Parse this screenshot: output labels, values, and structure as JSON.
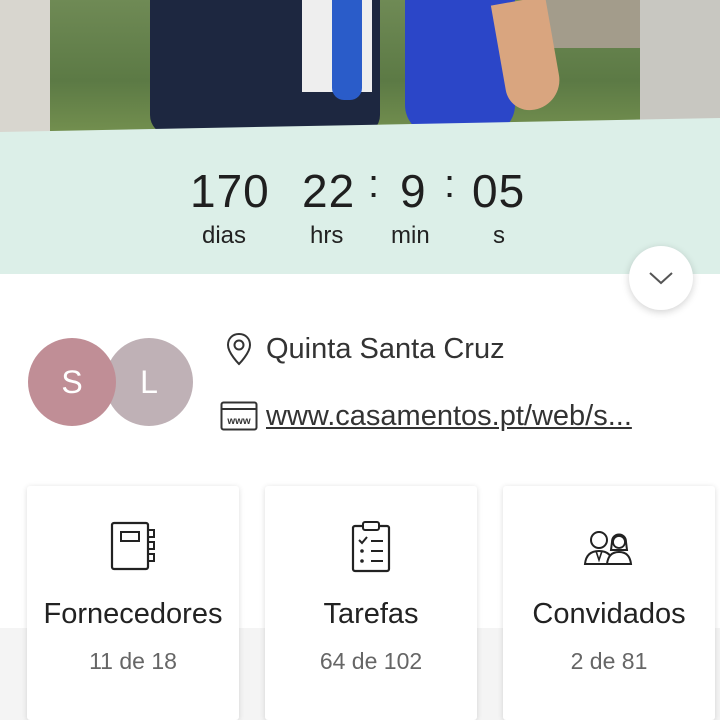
{
  "countdown": {
    "days": "170",
    "days_label": "dias",
    "hours": "22",
    "hours_label": "hrs",
    "minutes": "9",
    "minutes_label": "min",
    "seconds": "05",
    "seconds_label": "s",
    "separator": ":"
  },
  "expand_icon": "chevron-down-icon",
  "couple": {
    "initial_1": "S",
    "initial_1_color": "#c08e96",
    "initial_2": "L",
    "initial_2_color": "#bfb1b6"
  },
  "venue": {
    "icon": "location-pin-icon",
    "text": "Quinta Santa Cruz"
  },
  "website": {
    "icon": "www-icon",
    "badge": "www",
    "text": "www.casamentos.pt/web/s..."
  },
  "cards": [
    {
      "icon": "notebook-icon",
      "title": "Fornecedores",
      "count": "11 de 18"
    },
    {
      "icon": "checklist-icon",
      "title": "Tarefas",
      "count": "64 de 102"
    },
    {
      "icon": "guests-icon",
      "title": "Convidados",
      "count": "2 de 81"
    }
  ],
  "colors": {
    "countdown_band": "#dcefe8"
  }
}
